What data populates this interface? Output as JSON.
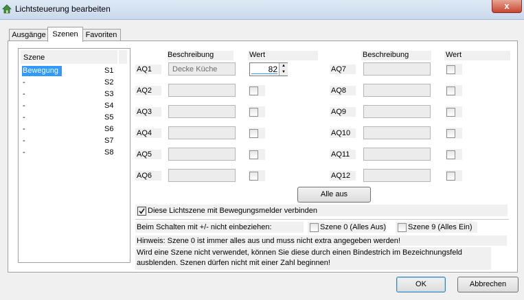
{
  "window": {
    "title": "Lichtsteuerung bearbeiten",
    "close_label": "x"
  },
  "tabs": [
    {
      "label": "Ausgänge"
    },
    {
      "label": "Szenen"
    },
    {
      "label": "Favoriten"
    }
  ],
  "scene_list": {
    "header": "Szene",
    "rows": [
      {
        "name": "Bewegung",
        "id": "S1",
        "selected": true
      },
      {
        "name": "-",
        "id": "S2"
      },
      {
        "name": "-",
        "id": "S3"
      },
      {
        "name": "-",
        "id": "S4"
      },
      {
        "name": "-",
        "id": "S5"
      },
      {
        "name": "-",
        "id": "S6"
      },
      {
        "name": "-",
        "id": "S7"
      },
      {
        "name": "-",
        "id": "S8"
      }
    ]
  },
  "outputs": {
    "header_desc": "Beschreibung",
    "header_value": "Wert",
    "left": [
      {
        "label": "AQ1",
        "desc": "Decke Küche",
        "value": "82"
      },
      {
        "label": "AQ2",
        "desc": ""
      },
      {
        "label": "AQ3",
        "desc": ""
      },
      {
        "label": "AQ4",
        "desc": ""
      },
      {
        "label": "AQ5",
        "desc": ""
      },
      {
        "label": "AQ6",
        "desc": ""
      }
    ],
    "right": [
      {
        "label": "AQ7",
        "desc": ""
      },
      {
        "label": "AQ8",
        "desc": ""
      },
      {
        "label": "AQ9",
        "desc": ""
      },
      {
        "label": "AQ10",
        "desc": ""
      },
      {
        "label": "AQ11",
        "desc": ""
      },
      {
        "label": "AQ12",
        "desc": ""
      }
    ]
  },
  "all_off_label": "Alle aus",
  "motion_sensor_label": "Diese Lichtszene mit Bewegungsmelder verbinden",
  "exclude_label": "Beim Schalten mit +/- nicht einbeziehen:",
  "scene0_label": "Szene 0 (Alles Aus)",
  "scene9_label": "Szene 9 (Alles Ein)",
  "hint1": "Hinweis: Szene 0 ist immer alles aus und muss nicht extra angegeben werden!",
  "hint2_line1": "Wird eine Szene nicht verwendet, können Sie diese durch einen Bindestrich im Bezeichnungsfeld",
  "hint2_line2": "ausblenden. Szenen dürfen nicht mit einer Zahl beginnen!",
  "buttons": {
    "ok": "OK",
    "cancel": "Abbrechen"
  }
}
